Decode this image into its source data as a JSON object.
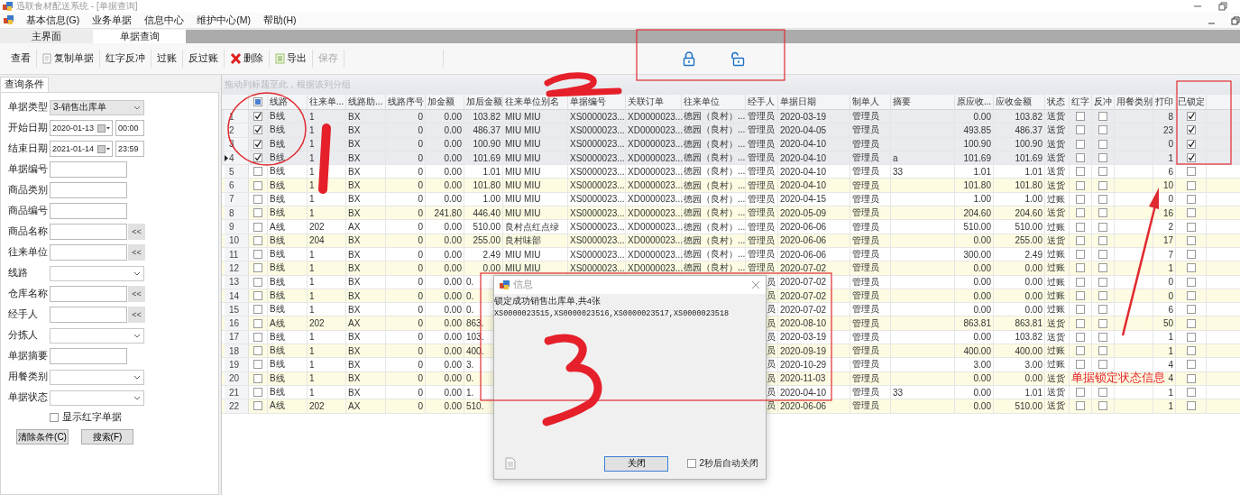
{
  "window": {
    "title": "迅联食材配送系统 - [单据查询]"
  },
  "menu": [
    "基本信息(G)",
    "业务单据",
    "信息中心",
    "维护中心(M)",
    "帮助(H)"
  ],
  "tabs": [
    {
      "label": "主界面",
      "selected": false
    },
    {
      "label": "单据查询",
      "selected": true
    }
  ],
  "toolbar": [
    {
      "label": "查看",
      "kind": "plain",
      "disabled": false
    },
    {
      "label": "复制单据",
      "kind": "copy",
      "disabled": false
    },
    {
      "label": "红字反冲",
      "kind": "plain",
      "disabled": false
    },
    {
      "label": "过账",
      "kind": "plain",
      "disabled": false
    },
    {
      "label": "反过账",
      "kind": "plain",
      "disabled": false
    },
    {
      "label": "删除",
      "kind": "delete",
      "disabled": false
    },
    {
      "label": "导出",
      "kind": "export",
      "disabled": false
    },
    {
      "label": "保存",
      "kind": "plain",
      "disabled": true
    }
  ],
  "lock_buttons": [
    {
      "kind": "lock"
    },
    {
      "kind": "unlock"
    }
  ],
  "query_panel": {
    "tab": "查询条件",
    "fields": [
      {
        "label": "单据类型",
        "kind": "combo",
        "value": "3-销售出库单"
      },
      {
        "label": "开始日期",
        "kind": "date",
        "value": "2020-01-13",
        "time": "00:00"
      },
      {
        "label": "结束日期",
        "kind": "date",
        "value": "2021-01-14",
        "time": "23:59"
      },
      {
        "label": "单据编号",
        "kind": "text"
      },
      {
        "label": "商品类别",
        "kind": "text"
      },
      {
        "label": "商品编号",
        "kind": "text"
      },
      {
        "label": "商品名称",
        "kind": "lookup",
        "button": "<<"
      },
      {
        "label": "往来单位",
        "kind": "lookup",
        "button": "<<"
      },
      {
        "label": "线路",
        "kind": "combo"
      },
      {
        "label": "仓库名称",
        "kind": "lookup",
        "button": "<<"
      },
      {
        "label": "经手人",
        "kind": "lookup",
        "button": "<<"
      },
      {
        "label": "分拣人",
        "kind": "combo"
      },
      {
        "label": "单据摘要",
        "kind": "text"
      },
      {
        "label": "用餐类别",
        "kind": "combo"
      },
      {
        "label": "单据状态",
        "kind": "combo"
      }
    ],
    "show_red": {
      "label": "显示红字单据",
      "checked": false
    },
    "buttons": [
      "清除条件(C)",
      "搜索(F)"
    ]
  },
  "table": {
    "group_hint": "拖动列标题至此，根据该列分组",
    "select_all_indeterminate": true,
    "columns": [
      {
        "label": "线路",
        "kind": "text"
      },
      {
        "label": "往来单...",
        "kind": "text"
      },
      {
        "label": "线路助...",
        "kind": "text"
      },
      {
        "label": "线路序号",
        "kind": "number"
      },
      {
        "label": "加金额",
        "kind": "number"
      },
      {
        "label": "加后金额",
        "kind": "number"
      },
      {
        "label": "往来单位别名",
        "kind": "text"
      },
      {
        "label": "单据编号",
        "kind": "text"
      },
      {
        "label": "关联订单",
        "kind": "text"
      },
      {
        "label": "往来单位",
        "kind": "text"
      },
      {
        "label": "经手人",
        "kind": "text"
      },
      {
        "label": "单据日期",
        "kind": "text"
      },
      {
        "label": "制单人",
        "kind": "text"
      },
      {
        "label": "摘要",
        "kind": "text"
      },
      {
        "label": "原应收...",
        "kind": "number"
      },
      {
        "label": "应收金额",
        "kind": "number"
      },
      {
        "label": "状态",
        "kind": "text"
      },
      {
        "label": "红字",
        "kind": "check"
      },
      {
        "label": "反冲",
        "kind": "check"
      },
      {
        "label": "用餐类别",
        "kind": "text"
      },
      {
        "label": "打印",
        "kind": "number"
      },
      {
        "label": "已锁定",
        "kind": "check"
      }
    ],
    "rows": [
      {
        "num": "1",
        "selected": true,
        "current": false,
        "checked": true,
        "cells": [
          "B线",
          "1",
          "BX",
          "0",
          "0.00",
          "103.82",
          "MIU MIU",
          "XS0000023...",
          "XD0000023...",
          "德园（良村）...",
          "管理员",
          "2020-03-19",
          "管理员",
          "",
          "0.00",
          "103.82",
          "送货",
          false,
          false,
          "",
          "8",
          true
        ]
      },
      {
        "num": "2",
        "selected": true,
        "current": false,
        "checked": true,
        "cells": [
          "B线",
          "1",
          "BX",
          "0",
          "0.00",
          "486.37",
          "MIU MIU",
          "XS0000023...",
          "XD0000023...",
          "德园（良村）...",
          "管理员",
          "2020-04-05",
          "管理员",
          "",
          "493.85",
          "486.37",
          "送货",
          false,
          false,
          "",
          "23",
          true
        ]
      },
      {
        "num": "3",
        "selected": true,
        "current": false,
        "checked": true,
        "cells": [
          "B线",
          "1",
          "BX",
          "0",
          "0.00",
          "100.90",
          "MIU MIU",
          "XS0000023...",
          "XD0000023...",
          "德园（良村）...",
          "管理员",
          "2020-04-10",
          "管理员",
          "",
          "100.90",
          "100.90",
          "送货",
          false,
          false,
          "",
          "0",
          true
        ]
      },
      {
        "num": "4",
        "selected": true,
        "current": true,
        "checked": true,
        "cells": [
          "B线",
          "1",
          "BX",
          "0",
          "0.00",
          "101.69",
          "MIU MIU",
          "XS0000023...",
          "XD0000023...",
          "德园（良村）...",
          "管理员",
          "2020-04-10",
          "管理员",
          "a",
          "101.69",
          "101.69",
          "送货",
          false,
          false,
          "",
          "1",
          true
        ]
      },
      {
        "num": "5",
        "selected": false,
        "current": false,
        "checked": false,
        "cells": [
          "B线",
          "1",
          "BX",
          "0",
          "0.00",
          "1.01",
          "MIU MIU",
          "XS0000023...",
          "XD0000023...",
          "德园（良村）...",
          "管理员",
          "2020-04-10",
          "管理员",
          "33",
          "1.01",
          "1.01",
          "送货",
          false,
          false,
          "",
          "6",
          false
        ]
      },
      {
        "num": "6",
        "selected": false,
        "current": false,
        "checked": false,
        "cells": [
          "B线",
          "1",
          "BX",
          "0",
          "0.00",
          "101.80",
          "MIU MIU",
          "XS0000023...",
          "XD0000023...",
          "德园（良村）...",
          "管理员",
          "2020-04-10",
          "管理员",
          "",
          "101.80",
          "101.80",
          "送货",
          false,
          false,
          "",
          "10",
          false
        ]
      },
      {
        "num": "7",
        "selected": false,
        "current": false,
        "checked": false,
        "cells": [
          "B线",
          "1",
          "BX",
          "0",
          "0.00",
          "1.00",
          "MIU MIU",
          "XS0000023...",
          "XD0000023...",
          "德园（良村）...",
          "管理员",
          "2020-04-15",
          "管理员",
          "",
          "1.00",
          "1.00",
          "过账",
          false,
          false,
          "",
          "0",
          false
        ]
      },
      {
        "num": "8",
        "selected": false,
        "current": false,
        "checked": false,
        "cells": [
          "B线",
          "1",
          "BX",
          "0",
          "241.80",
          "446.40",
          "MIU MIU",
          "XS0000023...",
          "XD0000023...",
          "德园（良村）...",
          "管理员",
          "2020-05-09",
          "管理员",
          "",
          "204.60",
          "204.60",
          "送货",
          false,
          false,
          "",
          "16",
          false
        ]
      },
      {
        "num": "9",
        "selected": false,
        "current": false,
        "checked": false,
        "cells": [
          "A线",
          "202",
          "AX",
          "0",
          "0.00",
          "510.00",
          "良村点红点绿",
          "XS0000023...",
          "XD0000023...",
          "德园（良村）...",
          "管理员",
          "2020-06-06",
          "管理员",
          "",
          "510.00",
          "510.00",
          "过账",
          false,
          false,
          "",
          "2",
          false
        ]
      },
      {
        "num": "10",
        "selected": false,
        "current": false,
        "checked": false,
        "cells": [
          "B线",
          "204",
          "BX",
          "0",
          "0.00",
          "255.00",
          "良村味部",
          "XS0000023...",
          "XD0000023...",
          "德园（良村）...",
          "管理员",
          "2020-06-06",
          "管理员",
          "",
          "0.00",
          "255.00",
          "送货",
          false,
          false,
          "",
          "17",
          false
        ]
      },
      {
        "num": "11",
        "selected": false,
        "current": false,
        "checked": false,
        "cells": [
          "B线",
          "1",
          "BX",
          "0",
          "0.00",
          "2.49",
          "MIU MIU",
          "XS0000023...",
          "XD0000023...",
          "德园（良村）...",
          "管理员",
          "2020-06-06",
          "管理员",
          "",
          "300.00",
          "2.49",
          "过账",
          false,
          false,
          "",
          "7",
          false
        ]
      },
      {
        "num": "12",
        "selected": false,
        "current": false,
        "checked": false,
        "cells": [
          "B线",
          "1",
          "BX",
          "0",
          "0.00",
          "0.00",
          "MIU MIU",
          "XS0000023...",
          "XD0000023...",
          "德园（良村）...",
          "管理员",
          "2020-07-02",
          "管理员",
          "",
          "0.00",
          "0.00",
          "过账",
          false,
          false,
          "",
          "1",
          false
        ]
      },
      {
        "num": "13",
        "selected": false,
        "current": false,
        "checked": false,
        "cells": [
          "B线",
          "1",
          "BX",
          "0",
          "0.00",
          "0.",
          null,
          null,
          null,
          null,
          "员",
          "2020-07-02",
          "管理员",
          "",
          "0.00",
          "0.00",
          "过账",
          false,
          false,
          "",
          "0",
          false
        ]
      },
      {
        "num": "14",
        "selected": false,
        "current": false,
        "checked": false,
        "cells": [
          "B线",
          "1",
          "BX",
          "0",
          "0.00",
          "0.",
          null,
          null,
          null,
          null,
          "员",
          "2020-07-02",
          "管理员",
          "",
          "0.00",
          "0.00",
          "过账",
          false,
          false,
          "",
          "0",
          false
        ]
      },
      {
        "num": "15",
        "selected": false,
        "current": false,
        "checked": false,
        "cells": [
          "B线",
          "1",
          "BX",
          "0",
          "0.00",
          "0.",
          null,
          null,
          null,
          null,
          "员",
          "2020-07-02",
          "管理员",
          "",
          "0.00",
          "0.00",
          "过账",
          false,
          false,
          "",
          "6",
          false
        ]
      },
      {
        "num": "16",
        "selected": false,
        "current": false,
        "checked": false,
        "cells": [
          "A线",
          "202",
          "AX",
          "0",
          "0.00",
          "863.",
          null,
          null,
          null,
          null,
          "员",
          "2020-08-10",
          "管理员",
          "",
          "863.81",
          "863.81",
          "送货",
          false,
          false,
          "",
          "50",
          false
        ]
      },
      {
        "num": "17",
        "selected": false,
        "current": false,
        "checked": false,
        "cells": [
          "B线",
          "1",
          "BX",
          "0",
          "0.00",
          "103.",
          null,
          null,
          null,
          null,
          "员",
          "2020-03-19",
          "管理员",
          "",
          "0.00",
          "103.82",
          "送货",
          false,
          false,
          "",
          "1",
          false
        ]
      },
      {
        "num": "18",
        "selected": false,
        "current": false,
        "checked": false,
        "cells": [
          "B线",
          "1",
          "BX",
          "0",
          "0.00",
          "400.",
          null,
          null,
          null,
          null,
          "员",
          "2020-09-19",
          "管理员",
          "",
          "400.00",
          "400.00",
          "过账",
          false,
          false,
          "",
          "1",
          false
        ]
      },
      {
        "num": "19",
        "selected": false,
        "current": false,
        "checked": false,
        "cells": [
          "B线",
          "1",
          "BX",
          "0",
          "0.00",
          "3.",
          null,
          null,
          null,
          null,
          "员",
          "2020-10-29",
          "管理员",
          "",
          "3.00",
          "3.00",
          "过账",
          false,
          false,
          "",
          "4",
          false
        ]
      },
      {
        "num": "20",
        "selected": false,
        "current": false,
        "checked": false,
        "cells": [
          "B线",
          "1",
          "BX",
          "0",
          "0.00",
          "0.",
          null,
          null,
          null,
          null,
          "员",
          "2020-11-03",
          "管理员",
          "",
          "0.00",
          "0.00",
          "送货",
          null,
          null,
          "",
          "4",
          false
        ]
      },
      {
        "num": "21",
        "selected": false,
        "current": false,
        "checked": false,
        "cells": [
          "B线",
          "1",
          "BX",
          "0",
          "0.00",
          "1.",
          null,
          null,
          null,
          null,
          "员",
          "2020-04-10",
          "管理员",
          "33",
          "0.00",
          "1.01",
          "送货",
          false,
          false,
          "",
          "1",
          false
        ]
      },
      {
        "num": "22",
        "selected": false,
        "current": false,
        "checked": false,
        "cells": [
          "A线",
          "202",
          "AX",
          "0",
          "0.00",
          "510.",
          null,
          null,
          null,
          null,
          "员",
          "2020-06-06",
          "管理员",
          "",
          "0.00",
          "510.00",
          "送货",
          false,
          false,
          "",
          "1",
          false
        ]
      }
    ]
  },
  "dialog": {
    "title": "信息",
    "lines": [
      "锁定成功销售出库单,共4张",
      "XS0000023515,XS0000023516,XS0000023517,XS0000023518"
    ],
    "close_button": "关闭",
    "auto_close": {
      "label": "2秒后自动关闭",
      "checked": false
    }
  },
  "annotations": {
    "note": "单据锁定状态信息"
  }
}
